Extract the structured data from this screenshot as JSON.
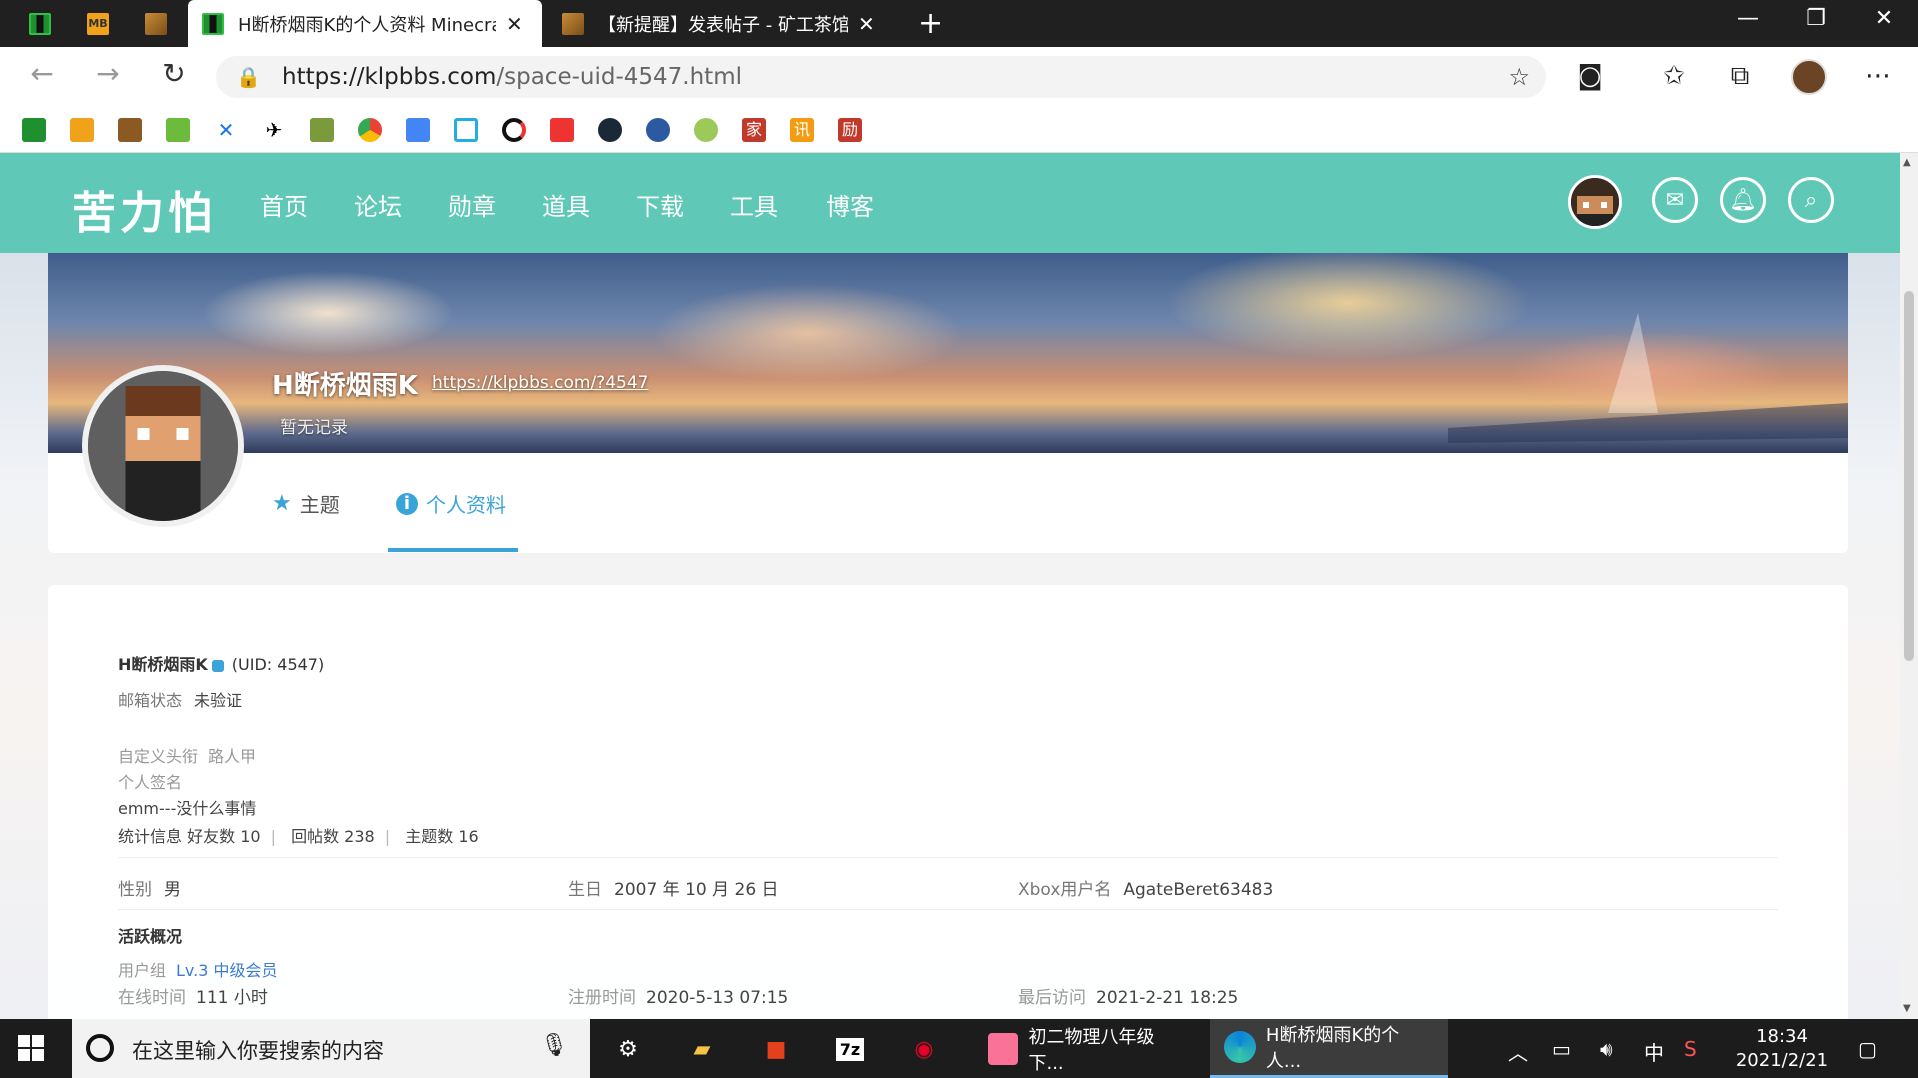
{
  "browser": {
    "tabs": [
      {
        "title": "H断桥烟雨K的个人资料 Minecraft",
        "active": true
      },
      {
        "title": "【新提醒】发表帖子 - 矿工茶馆",
        "active": false
      }
    ],
    "pinned_icons": [
      "creeper-icon",
      "mb-icon",
      "box-icon"
    ],
    "pinned_mb_text": "MB",
    "url_host": "https://klpbbs.com",
    "url_path": "/space-uid-4547.html",
    "window_controls": [
      "minimize",
      "restore",
      "close"
    ]
  },
  "bookmarks": [
    "minecraft",
    "mb",
    "box",
    "green-box",
    "x",
    "paper-plane",
    "grass-block",
    "chrome",
    "translate",
    "bilibili",
    "curseforge",
    "lock",
    "steam",
    "controller",
    "face",
    "家",
    "讯",
    "励"
  ],
  "site": {
    "logo": "苦力怕",
    "nav": [
      "首页",
      "论坛",
      "勋章",
      "道具",
      "下载",
      "工具",
      "博客"
    ],
    "accent": "#5fc8b6"
  },
  "profile": {
    "name": "H断桥烟雨K",
    "link": "https://klpbbs.com/?4547",
    "status": "暂无记录",
    "tabs": [
      "主题",
      "个人资料"
    ],
    "active_tab": "个人资料"
  },
  "info": {
    "uid_text": "(UID: 4547)",
    "email_label": "邮箱状态",
    "email_value": "未验证",
    "title_label": "自定义头衔",
    "title_value": "路人甲",
    "signature_label": "个人签名",
    "signature_value": "emm---没什么事情",
    "stats_label": "统计信息",
    "stats": [
      {
        "label": "好友数",
        "value": "10"
      },
      {
        "label": "回帖数",
        "value": "238"
      },
      {
        "label": "主题数",
        "value": "16"
      }
    ],
    "gender_label": "性别",
    "gender_value": "男",
    "birthday_label": "生日",
    "birthday_value": "2007 年 10 月 26 日",
    "xbox_label": "Xbox用户名",
    "xbox_value": "AgateBeret63483",
    "activity_heading": "活跃概况",
    "group_label": "用户组",
    "group_value": "Lv.3 中级会员",
    "online_label": "在线时间",
    "online_value": "111 小时",
    "reg_label": "注册时间",
    "reg_value": "2020-5-13 07:15",
    "last_label": "最后访问",
    "last_value": "2021-2-21 18:25"
  },
  "taskbar": {
    "search_placeholder": "在这里输入你要搜索的内容",
    "windows": [
      {
        "label": "初二物理八年级下...",
        "active": false
      },
      {
        "label": "H断桥烟雨K的个人...",
        "active": true
      }
    ],
    "app_7z": "7z",
    "ime": "中",
    "time": "18:34",
    "date": "2021/2/21"
  }
}
